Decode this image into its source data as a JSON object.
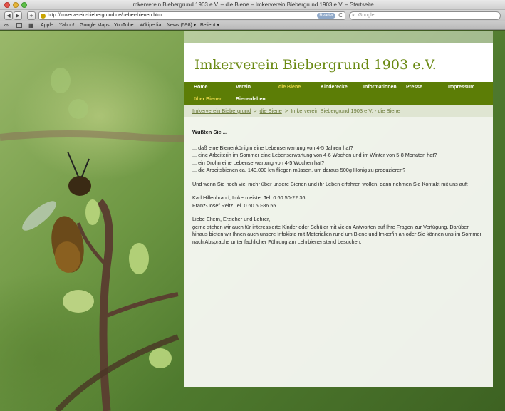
{
  "window": {
    "title": "Imkerverein Biebergrund 1903 e.V. – die Biene – Imkerverein Biebergrund 1903 e.V. – Startseite"
  },
  "toolbar": {
    "back": "◀",
    "forward": "▶",
    "add": "+",
    "url": "http://imkerverein-biebergrund.de/ueber-bienen.html",
    "reader": "Reader",
    "reload": "C",
    "search_placeholder": "Google"
  },
  "bookmarks": [
    "Apple",
    "Yahoo!",
    "Google Maps",
    "YouTube",
    "Wikipedia",
    "News (598) ▾",
    "Beliebt ▾"
  ],
  "site": {
    "title": "Imkerverein Biebergrund 1903 e.V."
  },
  "menu": [
    {
      "label": "Home"
    },
    {
      "label": "Verein"
    },
    {
      "label": "die Biene",
      "active": true
    },
    {
      "label": "Kinderecke"
    },
    {
      "label": "Informationen"
    },
    {
      "label": "Presse"
    },
    {
      "label": "Impressum"
    },
    {
      "label": "über Bienen",
      "active": true
    },
    {
      "label": "Bienenleben"
    }
  ],
  "breadcrumb": {
    "items": [
      "Imkerverein Biebergrund",
      "die Biene",
      "Imkerverein Biebergrund 1903 e.V. - die Biene"
    ],
    "separator": ">"
  },
  "content": {
    "heading": "Wußten Sie ...",
    "facts": [
      "... daß eine Bienenkönigin eine Lebenserwartung von 4-5 Jahren hat?",
      "... eine Arbeiterin im Sommer eine Lebenserwartung von 4-6 Wochen und im Winter von 5-8 Monaten hat?",
      "... ein Drohn eine Lebenserwartung von 4-5 Wochen hat?",
      "... die Arbeitsbienen ca. 140.000 km fliegen müssen, um daraus 500g Honig zu produzieren?"
    ],
    "contact_intro": "Und wenn Sie noch viel mehr über unsere Bienen und ihr Leben erfahren wollen, dann nehmen Sie Kontakt mit uns auf:",
    "contacts": [
      "Karl Hillenbrand, Imkermeister Tel. 0 60 50-22 36",
      "Franz-Josef Reitz Tel. 0 60 50-86 55"
    ],
    "parents_greeting": "Liebe Eltern, Erzieher und Lehrer,",
    "parents_text": "gerne stehen wir auch für interessierte Kinder oder Schüler mit vielen Antworten auf Ihre Fragen zur Verfügung. Darüber hinaus bieten wir Ihnen auch unsere Infokiste mit Materialien rund um Biene und Imker/in an oder Sie können uns im Sommer nach Absprache unter fachlicher Führung am Lehrbienenstand besuchen."
  }
}
